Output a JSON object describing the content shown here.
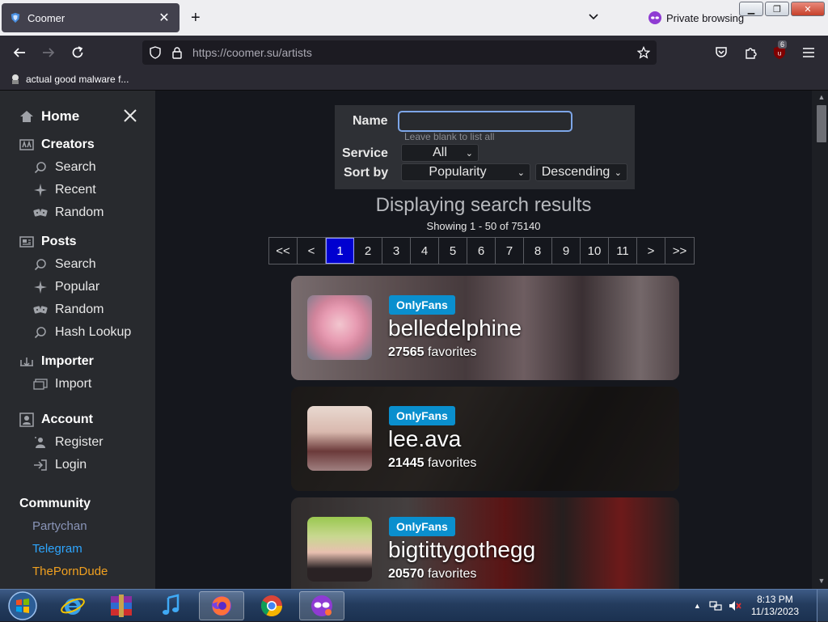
{
  "browser": {
    "tab_title": "Coomer",
    "private_label": "Private browsing",
    "url_host": "https://coomer.su",
    "url_path": "/artists",
    "bookmark_label": "actual good malware f...",
    "extension_badge": "6"
  },
  "sidebar": {
    "home": "Home",
    "creators": {
      "title": "Creators",
      "items": [
        "Search",
        "Recent",
        "Random"
      ]
    },
    "posts": {
      "title": "Posts",
      "items": [
        "Search",
        "Popular",
        "Random",
        "Hash Lookup"
      ]
    },
    "importer": {
      "title": "Importer",
      "items": [
        "Import"
      ]
    },
    "account": {
      "title": "Account",
      "items": [
        "Register",
        "Login"
      ]
    },
    "community": {
      "title": "Community",
      "links": [
        {
          "label": "Partychan",
          "color": "#8a95b8"
        },
        {
          "label": "Telegram",
          "color": "#2ea6ff"
        },
        {
          "label": "ThePornDude",
          "color": "#f0a020"
        }
      ]
    }
  },
  "search": {
    "name_label": "Name",
    "name_value": "",
    "name_hint": "Leave blank to list all",
    "service_label": "Service",
    "service_value": "All",
    "sort_label": "Sort by",
    "sort_value": "Popularity",
    "order_value": "Descending"
  },
  "results": {
    "title": "Displaying search results",
    "count": "Showing 1 - 50 of 75140"
  },
  "pager": [
    "<<",
    "<",
    "1",
    "2",
    "3",
    "4",
    "5",
    "6",
    "7",
    "8",
    "9",
    "10",
    "11",
    ">",
    ">>"
  ],
  "pager_current": "1",
  "cards": [
    {
      "service": "OnlyFans",
      "name": "belledelphine",
      "favorites": "27565",
      "fav_label": "favorites"
    },
    {
      "service": "OnlyFans",
      "name": "lee.ava",
      "favorites": "21445",
      "fav_label": "favorites"
    },
    {
      "service": "OnlyFans",
      "name": "bigtittygothegg",
      "favorites": "20570",
      "fav_label": "favorites"
    }
  ],
  "taskbar": {
    "time": "8:13 PM",
    "date": "11/13/2023"
  },
  "colors": {
    "accent_blue": "#0a8fce",
    "pager_current": "#0000d0",
    "sidebar_bg": "#282a2e",
    "page_bg": "#15171d"
  }
}
